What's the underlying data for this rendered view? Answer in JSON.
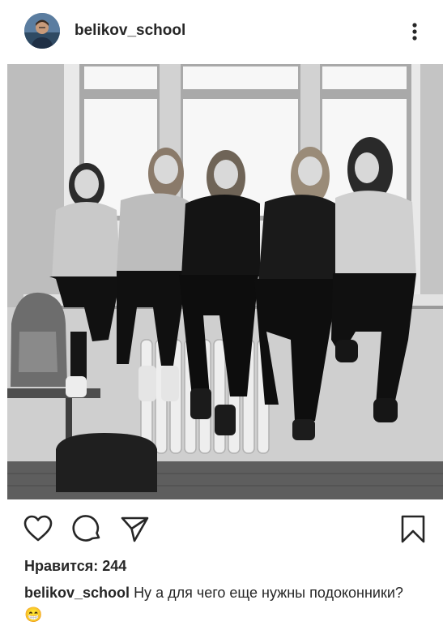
{
  "post": {
    "username": "belikov_school",
    "likes_label": "Нравится: 244",
    "caption_user": "belikov_school",
    "caption_text": "Ну а для чего еще нужны подоконники?",
    "caption_emoji": "😁"
  },
  "icons": {
    "more": "more-vertical-icon",
    "like": "heart-icon",
    "comment": "comment-icon",
    "share": "send-icon",
    "save": "bookmark-icon"
  },
  "colors": {
    "text": "#262626",
    "background": "#ffffff"
  }
}
